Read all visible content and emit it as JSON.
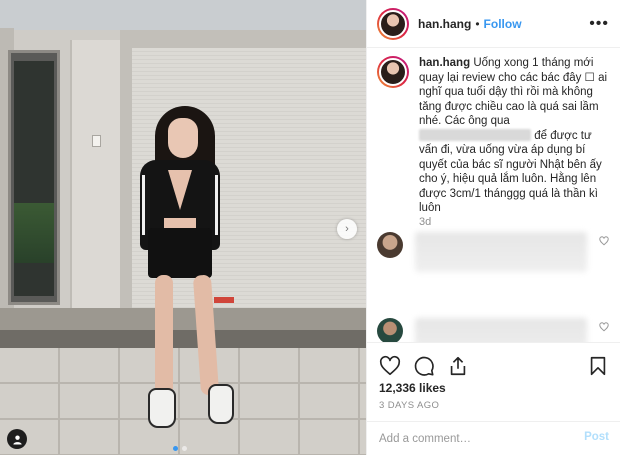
{
  "post": {
    "username": "han.hang",
    "follow_label": "Follow",
    "header_separator": "•",
    "more_glyph": "•••",
    "caption_part1": "Uống xong 1 tháng mới quay lại review cho các bác đây ☐ ai nghĩ qua tuổi dậy thì rồi mà không tăng được chiều cao là quá sai lầm nhé. Các ông qua",
    "caption_part2": "để được tư vấn đi, vừa uống vừa áp dụng bí quyết của bác sĩ người Nhật bên ấy cho ý, hiệu quả lắm luôn. Hằng lên được 3cm/1 thánggg quá là thần kì luôn",
    "caption_age": "3d",
    "likes": "12,336 likes",
    "posted": "3 DAYS AGO",
    "comment_placeholder": "Add a comment…",
    "post_label": "Post"
  },
  "photo": {
    "next_glyph": "›",
    "carousel_dots": 2,
    "active_dot": 0
  },
  "colors": {
    "link_blue": "#3897f0",
    "post_disabled": "#b2dffc",
    "muted": "#8e8e8e"
  },
  "icons": [
    "heart-icon",
    "comment-icon",
    "share-icon",
    "bookmark-icon",
    "user-tag-icon",
    "chevron-right-icon",
    "more-icon"
  ]
}
